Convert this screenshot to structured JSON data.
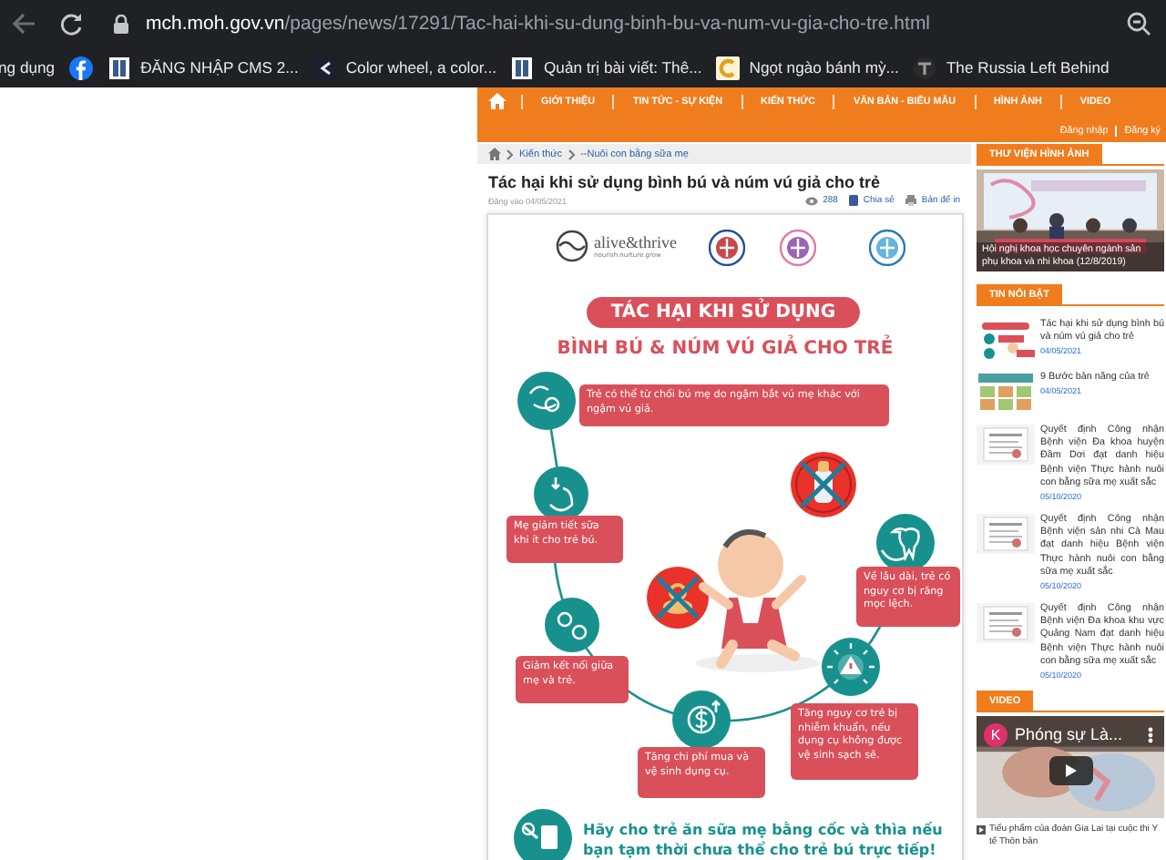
{
  "browser": {
    "url_host": "mch.moh.gov.vn",
    "url_path": "/pages/news/17291/Tac-hai-khi-su-dung-binh-bu-va-num-vu-gia-cho-tre.html",
    "bookmarks": [
      {
        "label": "ng dụng",
        "kind": "text"
      },
      {
        "kind": "facebook"
      },
      {
        "label": "ĐĂNG NHẬP CMS 2...",
        "kind": "page"
      },
      {
        "label": "Color wheel, a color...",
        "kind": "wheel"
      },
      {
        "label": "Quản trị bài viết: Thê...",
        "kind": "page"
      },
      {
        "label": "Ngọt ngào bánh mỳ...",
        "kind": "cup"
      },
      {
        "label": "The Russia Left Behind",
        "kind": "news"
      }
    ]
  },
  "nav": {
    "items": [
      "GIỚI THIỆU",
      "TIN TỨC - SỰ KIỆN",
      "KIẾN THỨC",
      "VĂN BẢN - BIỂU MẪU",
      "HÌNH ẢNH",
      "VIDEO"
    ],
    "auth": [
      "Đăng nhập",
      "Đăng ký"
    ]
  },
  "breadcrumb": [
    "Kiến thức",
    "--Nuôi con bằng sữa mẹ"
  ],
  "article": {
    "title": "Tác hại khi sử dụng bình bú và núm vú giả cho trẻ",
    "date": "Đăng vào 04/05/2021",
    "views": "288",
    "share": "Chia sẻ",
    "print": "Bản để in"
  },
  "infographic": {
    "logo_name": "alive&thrive",
    "logo_tagline": "nourish.nurture.grow",
    "title": "TÁC HẠI KHI SỬ DỤNG",
    "subtitle": "BÌNH BÚ & NÚM VÚ GIẢ CHO TRẺ",
    "harms": [
      "Trẻ có thể từ chối bú mẹ do ngậm bắt vú mẹ khác với ngậm vú giả.",
      "Mẹ giảm tiết sữa khi ít cho trẻ bú.",
      "Về lâu dài, trẻ có nguy cơ bị răng mọc lệch.",
      "Giảm kết nối giữa mẹ và trẻ.",
      "Tăng nguy cơ trẻ bị nhiễm khuẩn, nếu dụng cụ không được vệ sinh sạch sẽ.",
      "Tăng chi phí mua và vệ sinh dụng cụ."
    ],
    "advice": "Hãy cho trẻ ăn sữa mẹ bằng cốc và thìa nếu bạn tạm thời chưa thể cho trẻ bú trực tiếp!"
  },
  "sidebar": {
    "gallery": {
      "heading": "THƯ VIỆN HÌNH ẢNH",
      "caption": "Hội nghị khoa học chuyên ngành sản phụ khoa và nhi khoa (12/8/2019)"
    },
    "featured": {
      "heading": "TIN NỔI BẬT",
      "items": [
        {
          "title": "Tác hại khi sử dụng bình bú và núm vú giả cho trẻ",
          "date": "04/05/2021"
        },
        {
          "title": "9 Bước bản năng của trẻ",
          "date": "04/05/2021"
        },
        {
          "title": "Quyết định Công nhận Bệnh viện Đa khoa huyện Đầm Dơi đạt danh hiệu Bệnh viện Thực hành nuôi con bằng sữa mẹ xuất sắc",
          "date": "05/10/2020"
        },
        {
          "title": "Quyết định Công nhận Bệnh viện sản nhi Cà Mau đạt danh hiệu Bệnh viện Thực hành nuôi con bằng sữa mẹ xuất sắc",
          "date": "05/10/2020"
        },
        {
          "title": "Quyết định Công nhận Bệnh viện Đa khoa khu vực Quảng Nam đạt danh hiệu Bệnh viện Thực hành nuôi con bằng sữa mẹ xuất sắc",
          "date": "05/10/2020"
        }
      ]
    },
    "video": {
      "heading": "VIDEO",
      "channel_initial": "K",
      "title": "Phóng sự Là...",
      "caption": "Tiểu phẩm của đoàn Gia Lai tại cuộc thi Y tế Thôn bản"
    }
  }
}
